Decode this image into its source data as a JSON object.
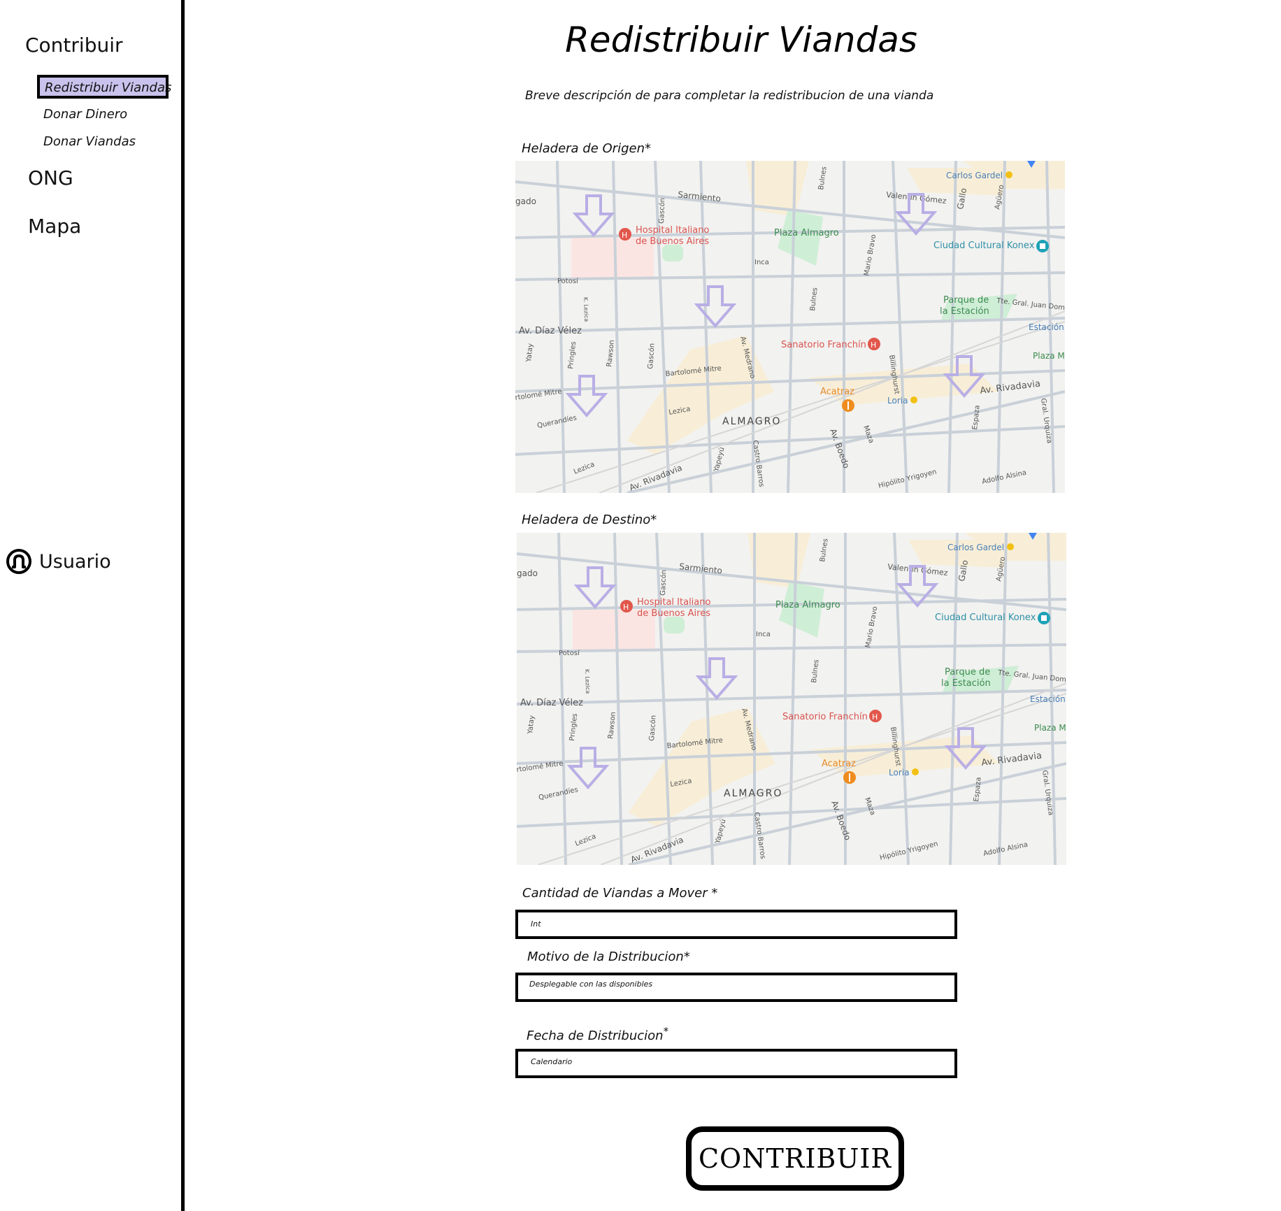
{
  "sidebar": {
    "contribuir": "Contribuir",
    "sub_items": [
      "Redistribuir Viandas",
      "Donar Dinero",
      "Donar Viandas"
    ],
    "ong": "ONG",
    "mapa": "Mapa",
    "user": "Usuario"
  },
  "main": {
    "title": "Redistribuir Viandas",
    "description": "Breve descripción de para completar la redistribucion de una vianda",
    "origen_label": "Heladera de Origen*",
    "destino_label": "Heladera de Destino*",
    "cantidad_label": "Cantidad de Viandas a Mover *",
    "cantidad_value": "Int",
    "motivo_label": "Motivo de la Distribucion*",
    "motivo_value": "Desplegable con las disponibles",
    "fecha_label": "Fecha de Distribucion",
    "fecha_asterisk": "*",
    "fecha_value": "Calendario",
    "submit": "CONTRIBUIR"
  },
  "map": {
    "labels": {
      "carlos_gardel": "Carlos Gardel",
      "sarmiento": "Sarmiento",
      "valentin_gomez": "Valentín Gómez",
      "gallo": "Gallo",
      "aguero": "Agüero",
      "gado": "gado",
      "gascon": "Gascón",
      "hospital": "Hospital Italiano",
      "hospital2": "de Buenos Aires",
      "plaza_almagro": "Plaza Almagro",
      "ciudad_cultural": "Ciudad Cultural Konex",
      "inca": "Inca",
      "potosi": "Potosí",
      "bulnes": "Bulnes",
      "mario_bravo": "Mario Bravo",
      "parque": "Parque de",
      "parque2": "la Estación",
      "tte_gral": "Tte. Gral. Juan Dom",
      "diaz_velez": "Av. Díaz Vélez",
      "estacion": "Estación C",
      "sanatorio": "Sanatorio Franchín",
      "plaza_m": "Plaza M",
      "billinghurst": "Billinghurst",
      "yatay": "Yatay",
      "pringles": "Pringles",
      "rawson": "Rawson",
      "medrano": "Av. Medrano",
      "bartolome": "Bartolomé Mitre",
      "acatraz": "Acatraz",
      "loria": "Loria",
      "rivadavia": "Av. Rivadavia",
      "tolome": "rtolomé Mitre",
      "querandies": "Querandíes",
      "lezica": "Lezica",
      "almagro": "ALMAGRO",
      "espaza": "Espaza",
      "gral_urquiza": "Gral. Urquiza",
      "boedo": "Av. Boedo",
      "maza": "Maza",
      "castro_barros": "Castro Barros",
      "yapeyu": "Yapeyú",
      "hipolito": "Hipólito Yrigoyen",
      "adolfo_alsina": "Adolfo Alsina",
      "rivadavia2": "Av. Rivadavia",
      "lezica2": "Lezica",
      "k_lezica": "K. Lezica"
    }
  }
}
